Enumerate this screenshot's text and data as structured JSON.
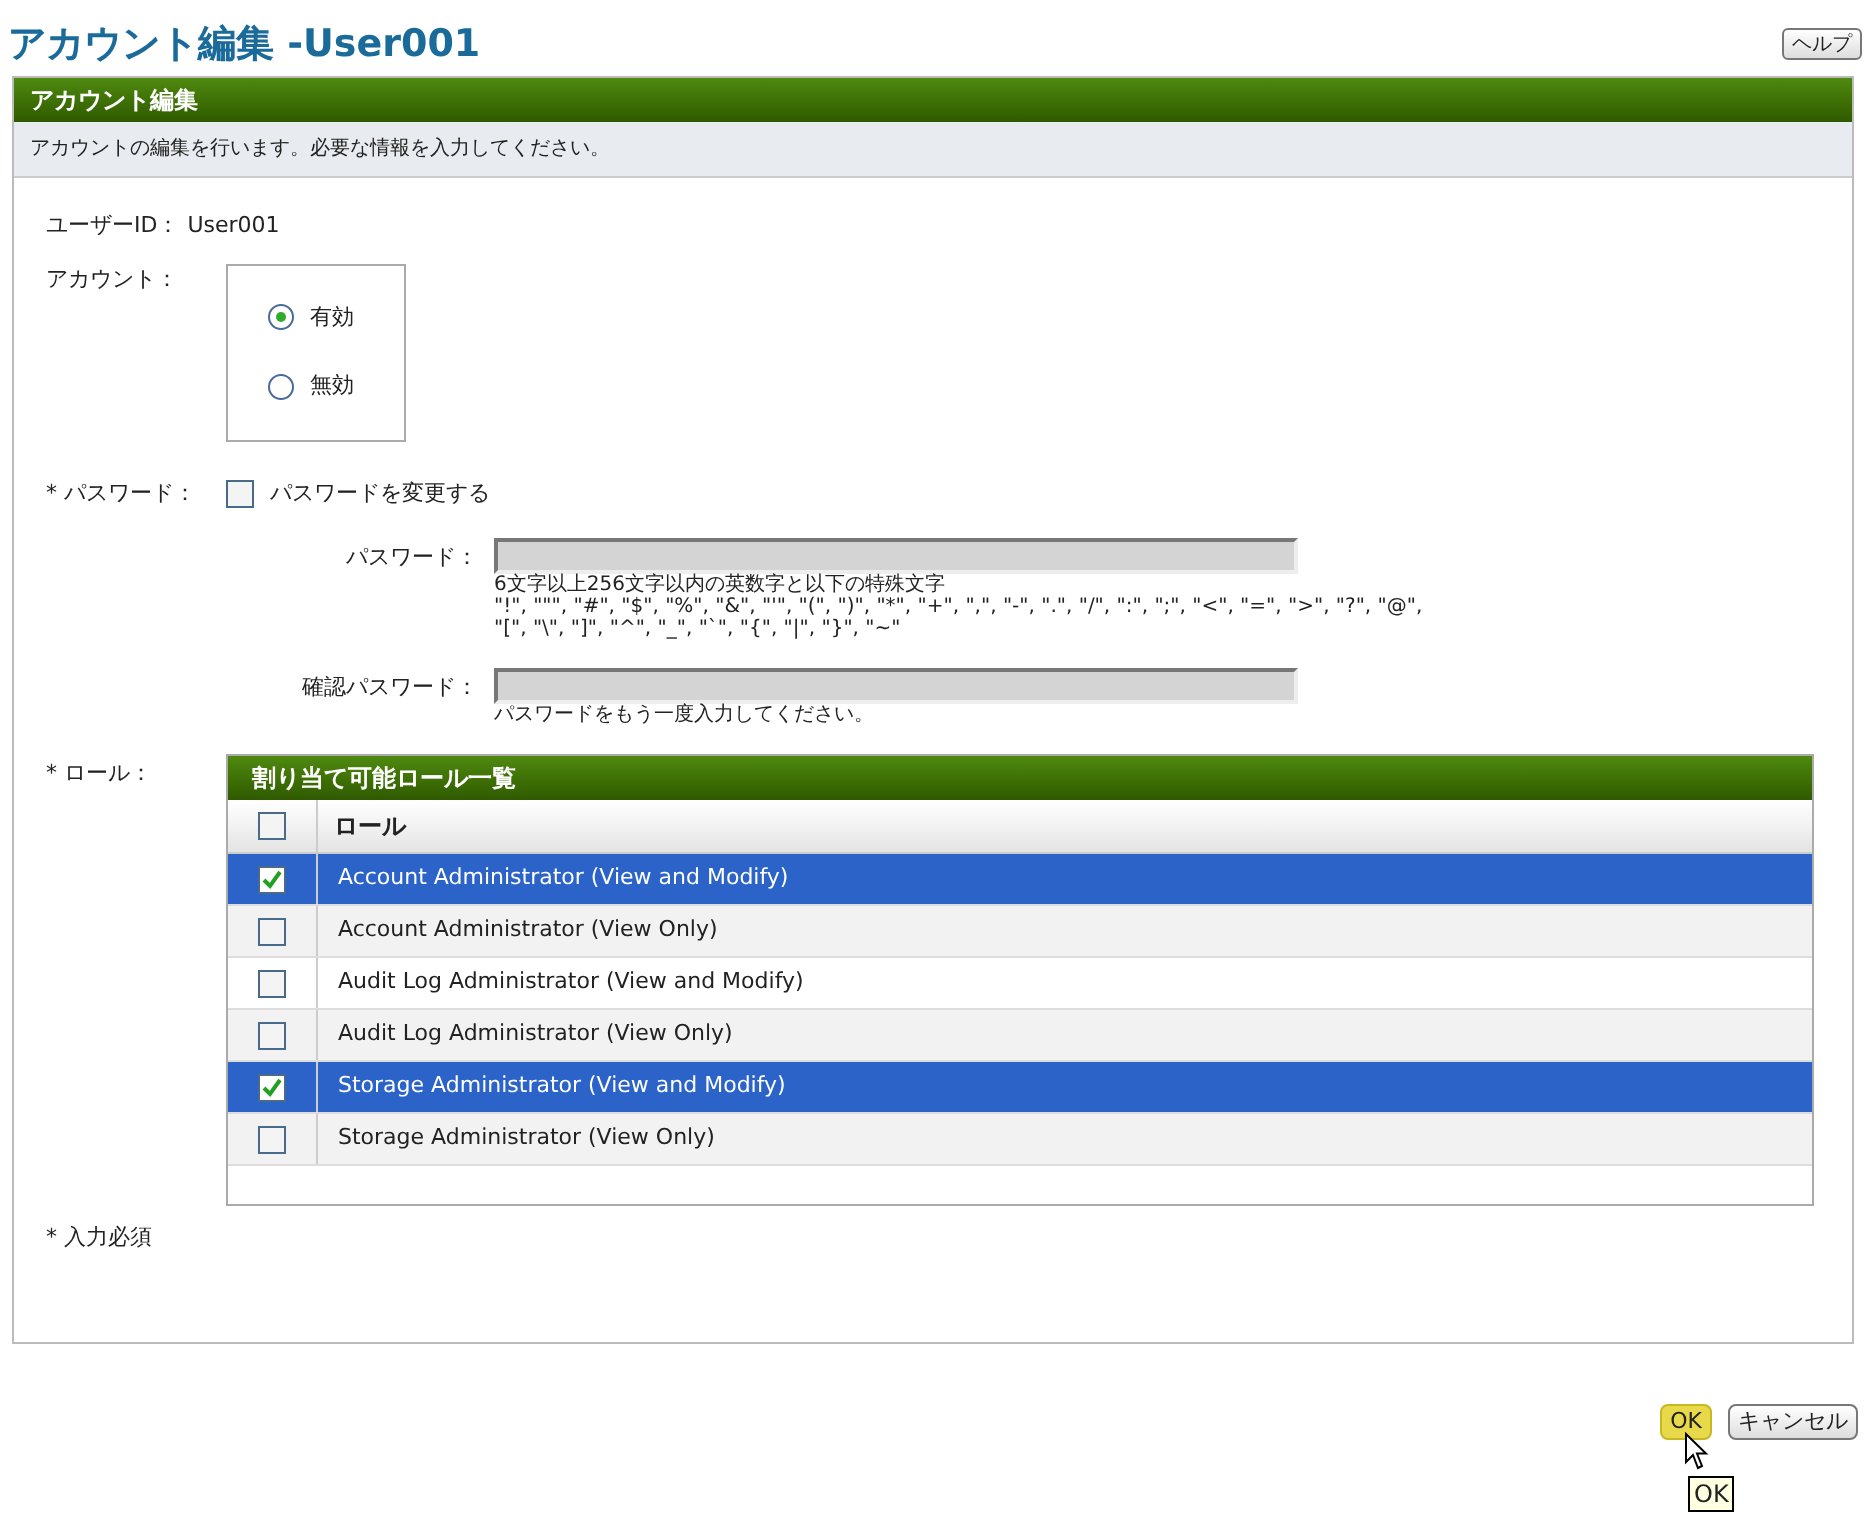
{
  "page_title": "アカウント編集 -User001",
  "help_button": "ヘルプ",
  "panel": {
    "title": "アカウント編集",
    "description": "アカウントの編集を行います。必要な情報を入力してください。"
  },
  "user_id": {
    "label": "ユーザーID：",
    "value": "User001"
  },
  "account": {
    "label": "アカウント：",
    "options": [
      {
        "label": "有効",
        "selected": true
      },
      {
        "label": "無効",
        "selected": false
      }
    ]
  },
  "password": {
    "required_mark": "*",
    "label": "パスワード：",
    "change_checkbox": {
      "label": "パスワードを変更する",
      "checked": false
    },
    "fields": [
      {
        "label": "パスワード：",
        "disabled": true,
        "hint_lines": [
          "6文字以上256文字以内の英数字と以下の特殊文字",
          "\"!\", \"\"\", \"#\", \"$\", \"%\", \"&\", \"'\", \"(\", \")\", \"*\", \"+\", \",\", \"-\", \".\", \"/\", \":\", \";\", \"<\", \"=\", \">\", \"?\", \"@\",",
          "\"[\", \"\\\", \"]\", \"^\", \"_\", \"`\", \"{\", \"|\", \"}\", \"~\""
        ]
      },
      {
        "label": "確認パスワード：",
        "disabled": true,
        "hint_lines": [
          "パスワードをもう一度入力してください。"
        ]
      }
    ]
  },
  "roles": {
    "required_mark": "*",
    "label": "ロール：",
    "table_title": "割り当て可能ロール一覧",
    "column": "ロール",
    "select_all_checked": false,
    "rows": [
      {
        "name": "Account Administrator (View and Modify)",
        "selected": true
      },
      {
        "name": "Account Administrator (View Only)",
        "selected": false
      },
      {
        "name": "Audit Log Administrator (View and Modify)",
        "selected": false
      },
      {
        "name": "Audit Log Administrator (View Only)",
        "selected": false
      },
      {
        "name": "Storage Administrator (View and Modify)",
        "selected": true
      },
      {
        "name": "Storage Administrator (View Only)",
        "selected": false
      }
    ]
  },
  "required_note": "* 入力必須",
  "buttons": [
    {
      "label": "OK",
      "kind": "primary"
    },
    {
      "label": "キャンセル",
      "kind": "default"
    }
  ],
  "tooltip": "OK"
}
